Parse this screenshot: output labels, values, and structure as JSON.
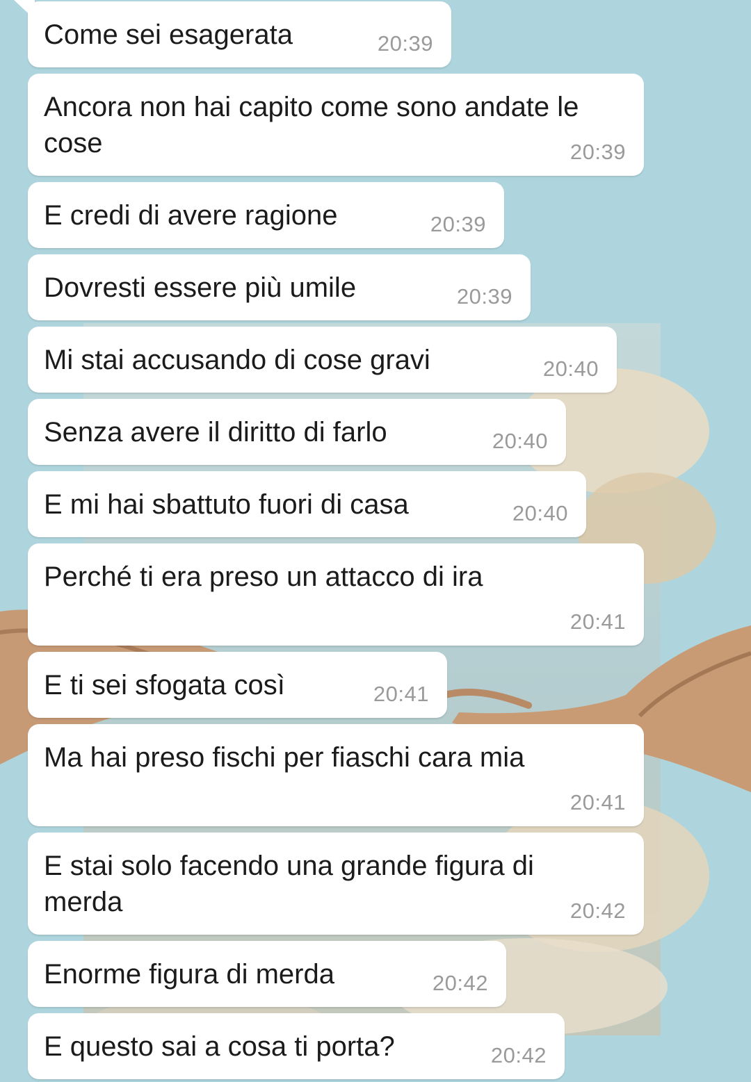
{
  "messages": [
    {
      "text": "Come sei esagerata",
      "time": "20:39"
    },
    {
      "text": "Ancora non hai capito come sono andate le cose",
      "time": "20:39"
    },
    {
      "text": "E credi di avere ragione",
      "time": "20:39"
    },
    {
      "text": "Dovresti essere più umile",
      "time": "20:39"
    },
    {
      "text": "Mi stai accusando di cose gravi",
      "time": "20:40"
    },
    {
      "text": "Senza avere il diritto di farlo",
      "time": "20:40"
    },
    {
      "text": "E mi hai sbattuto fuori di casa",
      "time": "20:40"
    },
    {
      "text": "Perché ti era preso un attacco di ira",
      "time": "20:41"
    },
    {
      "text": "E ti sei sfogata così",
      "time": "20:41"
    },
    {
      "text": "Ma hai preso fischi per fiaschi cara mia",
      "time": "20:41"
    },
    {
      "text": "E stai solo facendo una grande figura di merda",
      "time": "20:42"
    },
    {
      "text": "Enorme figura di merda",
      "time": "20:42"
    },
    {
      "text": "E questo sai a cosa ti porta?",
      "time": "20:42"
    }
  ]
}
